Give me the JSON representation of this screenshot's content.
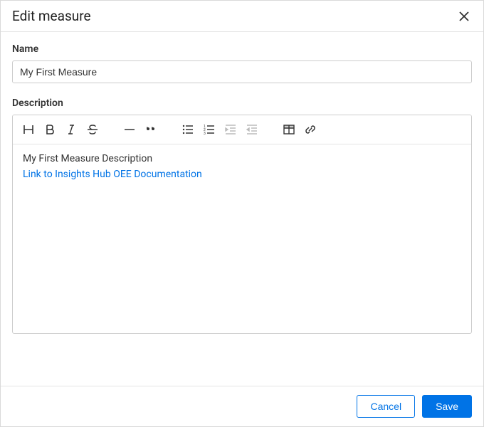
{
  "dialog": {
    "title": "Edit measure"
  },
  "form": {
    "name_label": "Name",
    "name_value": "My First Measure",
    "description_label": "Description"
  },
  "editor": {
    "text_line": "My First Measure Description",
    "link_text": "Link to Insights Hub OEE Documentation"
  },
  "footer": {
    "cancel_label": "Cancel",
    "save_label": "Save"
  }
}
